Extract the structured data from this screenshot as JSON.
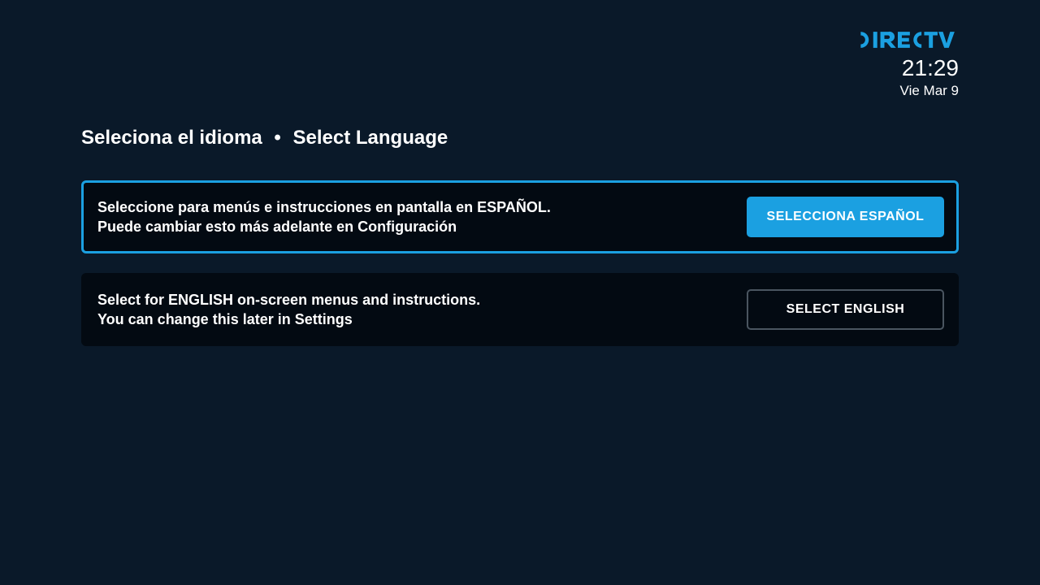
{
  "header": {
    "brand": "DIRECTV",
    "time": "21:29",
    "date": "Vie Mar 9"
  },
  "title": {
    "es": "Seleciona el idioma",
    "en": "Select Language"
  },
  "options": [
    {
      "line1": "Seleccione para menús e instrucciones en pantalla en ESPAÑOL.",
      "line2": "Puede cambiar esto más adelante en Configuración",
      "button": "SELECCIONA ESPAÑOL"
    },
    {
      "line1": "Select for ENGLISH on-screen menus and instructions.",
      "line2": "You can change this later in Settings",
      "button": "SELECT ENGLISH"
    }
  ]
}
